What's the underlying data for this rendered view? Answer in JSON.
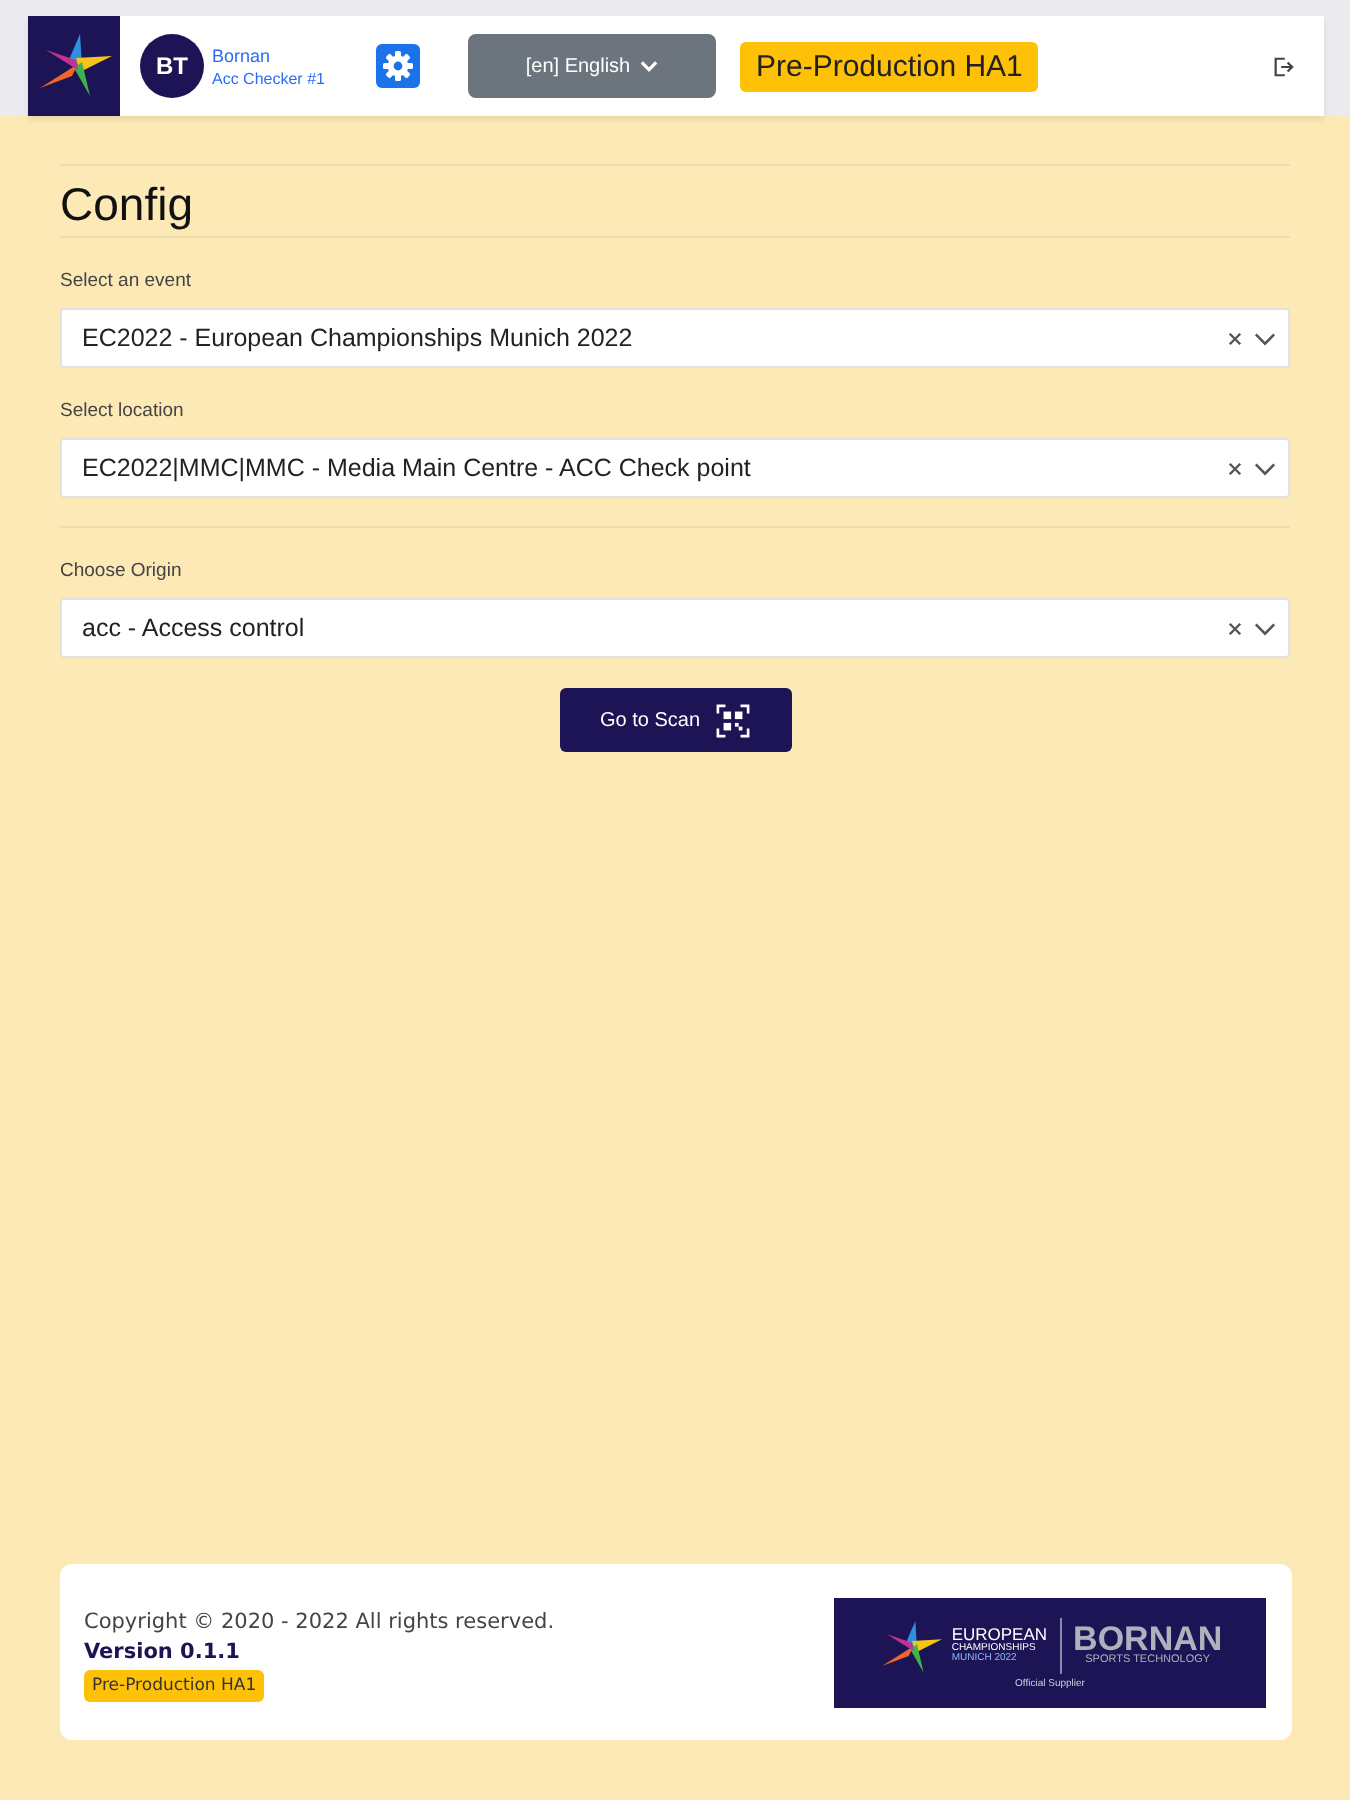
{
  "header": {
    "avatar_initials": "BT",
    "user_name": "Bornan",
    "user_role": "Acc Checker #1",
    "language": "[en] English",
    "environment_badge": "Pre-Production HA1"
  },
  "page": {
    "title": "Config"
  },
  "sections": [
    {
      "fields": [
        {
          "label": "Select an event",
          "value": "EC2022 - European Championships Munich 2022"
        },
        {
          "label": "Select location",
          "value": "EC2022|MMC|MMC - Media Main Centre - ACC Check point"
        }
      ]
    },
    {
      "fields": [
        {
          "label": "Choose Origin",
          "value": "acc - Access control"
        }
      ]
    }
  ],
  "scan_button": {
    "label": "Go to Scan"
  },
  "footer": {
    "copyright": "Copyright © 2020 - 2022 All rights reserved.",
    "version": "Version 0.1.1",
    "environment_badge": "Pre-Production HA1",
    "sponsor_logo": {
      "event_name": "EUROPEAN",
      "event_subtitle": "CHAMPIONSHIPS",
      "event_place": "MUNICH 2022",
      "brand": "BORNAN",
      "brand_subtitle": "SPORTS TECHNOLOGY",
      "caption": "Official Supplier"
    }
  }
}
